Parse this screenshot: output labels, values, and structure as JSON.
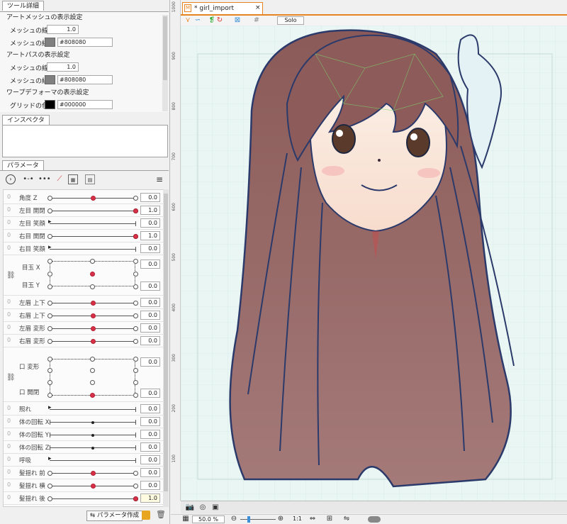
{
  "tool_detail": {
    "tab": "ツール詳細",
    "art_mesh_title": "アートメッシュの表示設定",
    "mesh_width_label": "メッシュの線幅",
    "mesh_width_value": "1.0",
    "mesh_color_label": "メッシュの線色",
    "mesh_color_hex": "#808080",
    "mesh_color": "#808080",
    "art_path_title": "アートパスの表示設定",
    "path_width_label": "メッシュの線幅",
    "path_width_value": "1.0",
    "path_color_label": "メッシュの線色",
    "path_color_hex": "#808080",
    "path_color": "#808080",
    "warp_title": "ワープデフォーマの表示設定",
    "grid_color_label": "グリッドの色",
    "grid_color_hex": "#000000",
    "grid_color": "#000000"
  },
  "inspector": {
    "tab": "インスペクタ"
  },
  "parameters": {
    "tab": "パラメータ",
    "create_button": "パラメータ作成",
    "rows": [
      {
        "label": "角度 Z",
        "value": "0.0",
        "knob": 0.5,
        "kind": "red"
      },
      {
        "label": "左目 開閉",
        "value": "1.0",
        "knob": 1.0,
        "kind": "red"
      },
      {
        "label": "左目 笑顔",
        "value": "0.0",
        "knob": 0.0,
        "kind": "arrow"
      },
      {
        "label": "右目 開閉",
        "value": "1.0",
        "knob": 1.0,
        "kind": "red"
      },
      {
        "label": "右目 笑顔",
        "value": "0.0",
        "knob": 0.0,
        "kind": "arrow"
      },
      {
        "label": "左眉 上下",
        "value": "0.0",
        "knob": 0.5,
        "kind": "red"
      },
      {
        "label": "右眉 上下",
        "value": "0.0",
        "knob": 0.5,
        "kind": "red"
      },
      {
        "label": "左眉 変形",
        "value": "0.0",
        "knob": 0.5,
        "kind": "red"
      },
      {
        "label": "右眉 変形",
        "value": "0.0",
        "knob": 0.5,
        "kind": "red"
      },
      {
        "label": "照れ",
        "value": "0.0",
        "knob": 0.0,
        "kind": "arrow"
      },
      {
        "label": "体の回転 X",
        "value": "0.0",
        "knob": 0.5,
        "kind": "dot"
      },
      {
        "label": "体の回転 Y",
        "value": "0.0",
        "knob": 0.5,
        "kind": "dot"
      },
      {
        "label": "体の回転 Z",
        "value": "0.0",
        "knob": 0.5,
        "kind": "dot"
      },
      {
        "label": "呼吸",
        "value": "0.0",
        "knob": 0.0,
        "kind": "arrow"
      },
      {
        "label": "髪揺れ 前",
        "value": "0.0",
        "knob": 0.5,
        "kind": "red"
      },
      {
        "label": "髪揺れ 横",
        "value": "0.0",
        "knob": 0.5,
        "kind": "red"
      },
      {
        "label": "髪揺れ 後",
        "value": "1.0",
        "knob": 1.0,
        "kind": "red"
      }
    ],
    "eyeball": {
      "x_label": "目玉 X",
      "y_label": "目玉 Y",
      "x_value": "0.0",
      "y_value": "0.0"
    },
    "mouth": {
      "form_label": "口 変形",
      "open_label": "口 開閉",
      "form_value": "0.0",
      "open_value": "0.0"
    }
  },
  "document": {
    "tab_title": "* girl_import",
    "solo_label": "Solo",
    "ruler_labels": [
      "1000",
      "900",
      "800",
      "700",
      "600",
      "500",
      "400",
      "300",
      "200",
      "100"
    ],
    "zoom": "50.0 %",
    "zoom_reset": "1:1"
  },
  "colors": {
    "accent": "#e8841f",
    "knob_red": "#d9304a"
  }
}
